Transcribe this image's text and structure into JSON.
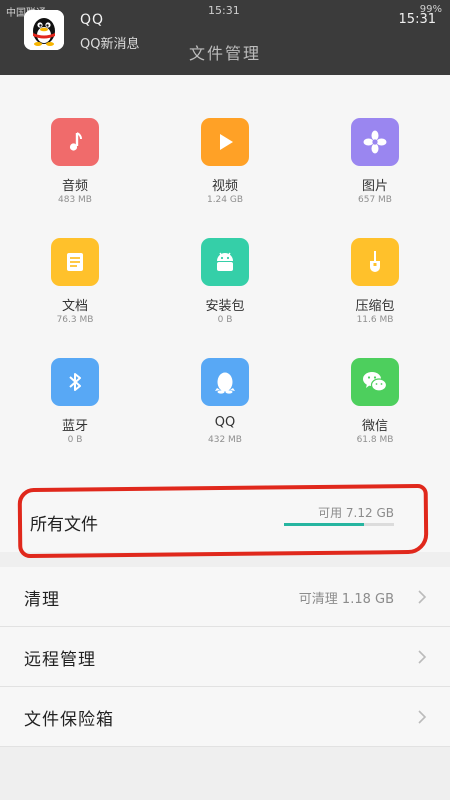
{
  "status": {
    "carrier": "中国联通",
    "clock": "15:31",
    "battery": "99%"
  },
  "notification": {
    "app": "QQ",
    "message": "QQ新消息",
    "time": "15:31"
  },
  "page_title": "文件管理",
  "categories": [
    {
      "name": "音频",
      "size": "483 MB",
      "color": "#f06b6b",
      "icon": "music-note-icon"
    },
    {
      "name": "视频",
      "size": "1.24 GB",
      "color": "#ffa126",
      "icon": "play-icon"
    },
    {
      "name": "图片",
      "size": "657 MB",
      "color": "#9a86f0",
      "icon": "flower-icon"
    },
    {
      "name": "文档",
      "size": "76.3 MB",
      "color": "#ffc12b",
      "icon": "document-icon"
    },
    {
      "name": "安装包",
      "size": "0 B",
      "color": "#35cfa8",
      "icon": "android-icon"
    },
    {
      "name": "压缩包",
      "size": "11.6 MB",
      "color": "#ffc12b",
      "icon": "zip-icon"
    },
    {
      "name": "蓝牙",
      "size": "0 B",
      "color": "#58a8f5",
      "icon": "bluetooth-icon"
    },
    {
      "name": "QQ",
      "size": "432 MB",
      "color": "#58a8f5",
      "icon": "qq-penguin-icon"
    },
    {
      "name": "微信",
      "size": "61.8 MB",
      "color": "#4dcf5d",
      "icon": "wechat-icon"
    }
  ],
  "all_files": {
    "label": "所有文件",
    "free": "可用 7.12 GB",
    "used_fraction": 0.73
  },
  "list": [
    {
      "label": "清理",
      "value": "可清理 1.18 GB"
    },
    {
      "label": "远程管理",
      "value": ""
    },
    {
      "label": "文件保险箱",
      "value": ""
    }
  ]
}
